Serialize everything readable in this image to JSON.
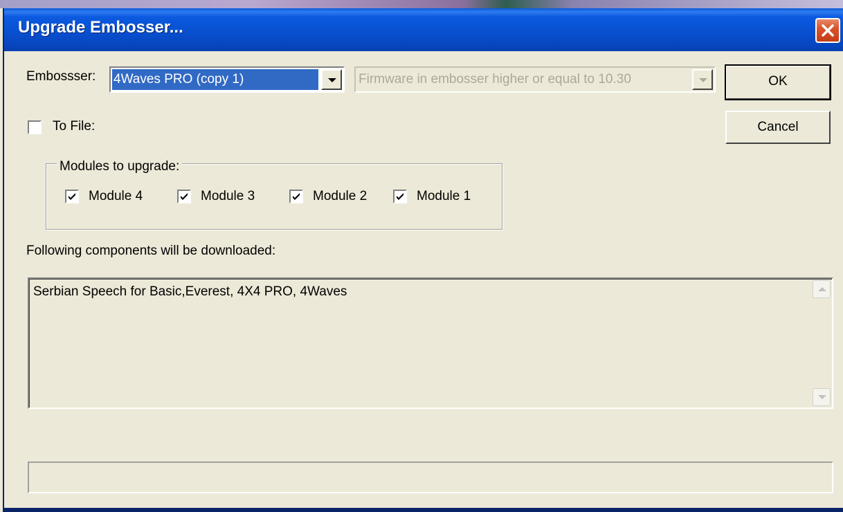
{
  "window": {
    "title": "Upgrade Embosser..."
  },
  "embosser": {
    "label": "Embossser:",
    "selected": "4Waves PRO (copy 1)"
  },
  "firmware": {
    "selected": "Firmware in embosser higher or equal to 10.30",
    "enabled": false
  },
  "buttons": {
    "ok": "OK",
    "cancel": "Cancel"
  },
  "to_file": {
    "label": "To File:",
    "checked": false
  },
  "modules": {
    "legend": "Modules to upgrade:",
    "items": [
      {
        "label": "Module 4",
        "checked": true
      },
      {
        "label": "Module 3",
        "checked": true
      },
      {
        "label": "Module 2",
        "checked": true
      },
      {
        "label": "Module 1",
        "checked": true
      }
    ]
  },
  "components": {
    "label": "Following components will be downloaded:",
    "text": "Serbian Speech for Basic,Everest, 4X4 PRO, 4Waves"
  },
  "status": {
    "text": ""
  },
  "icons": {
    "close": "close-icon",
    "dropdown": "chevron-down-icon",
    "check": "check-icon",
    "scroll_up": "scroll-up-icon",
    "scroll_down": "scroll-down-icon"
  },
  "colors": {
    "title_bar": "#0a58d8",
    "close_button": "#d9542c",
    "selection": "#316ac5",
    "dialog_face": "#ece9d8",
    "disabled_text": "#aca899"
  }
}
